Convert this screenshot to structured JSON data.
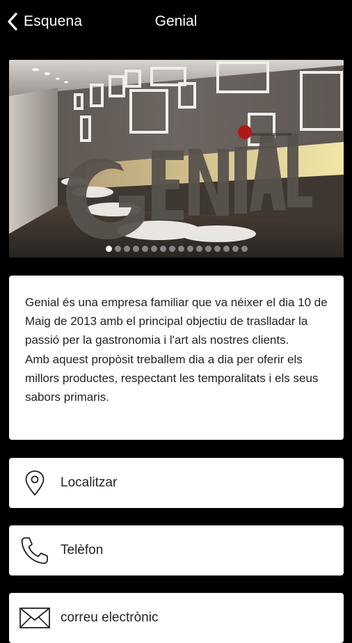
{
  "header": {
    "back_label": "Esquena",
    "title": "Genial"
  },
  "hero": {
    "logo_text": "GENIAL",
    "slide_count": 16,
    "active_slide": 1
  },
  "description": {
    "paragraphs": [
      "Genial és una empresa familiar que va néixer el dia 10 de Maig de 2013 amb el principal objectiu de traslladar la passió per la gastronomia i l'art als nostres clients.",
      "Amb aquest propòsit treballem dia a dia per oferir els millors productes, respectant les temporalitats i els seus sabors primaris."
    ]
  },
  "actions": [
    {
      "label": "Localitzar",
      "icon": "location-pin-icon"
    },
    {
      "label": "Telèfon",
      "icon": "phone-icon"
    },
    {
      "label": "correu electrònic",
      "icon": "envelope-icon"
    }
  ],
  "colors": {
    "background": "#000000",
    "card": "#ffffff",
    "text_dark": "#222222",
    "logo_dot": "#b01818"
  }
}
